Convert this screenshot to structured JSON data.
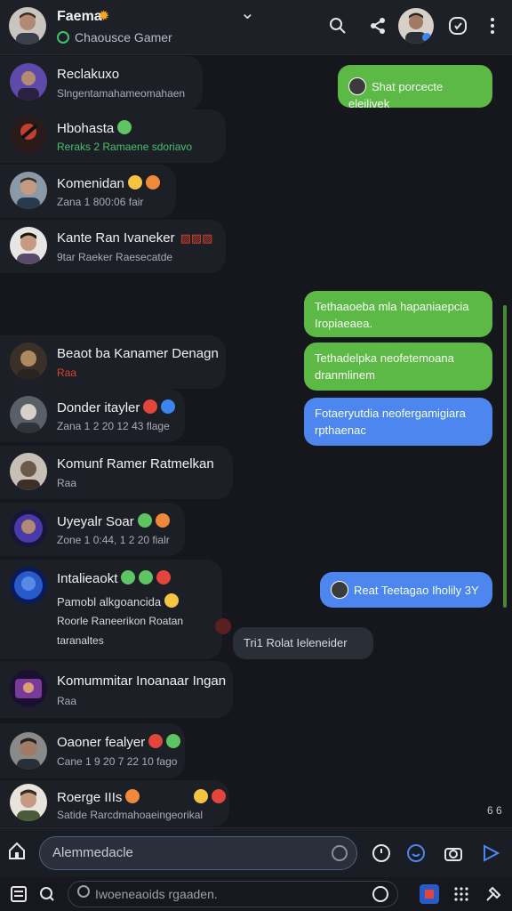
{
  "header": {
    "title": "Faema",
    "subtitle": "Chaousce Gamer",
    "emoji": "sun-emoji"
  },
  "contacts": [
    {
      "name": "Reclakuxo",
      "sub": "Slngentamahameomahaen",
      "sub_style": "grey",
      "avatar_color": "#5e4aa8"
    },
    {
      "name": "Hbohasta",
      "sub": "Reraks  2  Ramaene sdoriavo",
      "sub_style": "green",
      "avatar_color": "#a83b2c"
    },
    {
      "name": "Komenidan",
      "sub": "Zana 1 800:06  fair",
      "sub_style": "grey",
      "avatar_color": "#6a7a8c"
    },
    {
      "name": "Kante Ran Ivaneker",
      "sub": "9tar Raeker  Raesecatde",
      "sub_style": "grey",
      "avatar_color": "#4a4a58"
    },
    {
      "name": "Beaot ba Kanamer Denagn",
      "sub": "Raa",
      "sub_style": "grey",
      "avatar_color": "#5a4a38"
    },
    {
      "name": "Donder itayler",
      "sub": "Zana 1 2 20 12 43  flage",
      "sub_style": "grey",
      "avatar_color": "#4a5058"
    },
    {
      "name": "Komunf Ramer Ratmelkan",
      "sub": "Raa",
      "sub_style": "grey",
      "avatar_color": "#5a5048"
    },
    {
      "name": "Uyeyalr Soar",
      "sub": "Zone 1 0:44, 1 2 20 fialr",
      "sub_style": "grey",
      "avatar_color": "#3a2a78"
    },
    {
      "name": "Intalieaokt",
      "sub": "Pamobl alkgoancida",
      "sub2": "Roorle Raneerikon Roatan",
      "sub3": "taranaltes",
      "sub_style": "grey",
      "avatar_color": "#2a5ac8"
    },
    {
      "name": "Komummitar Inoanaar Ingan",
      "sub": "Raa",
      "sub_style": "grey",
      "avatar_color": "#6a3a78"
    },
    {
      "name": "Oaoner fealyer",
      "sub": "Cane 1 9 20 7 22 10 fago",
      "sub_style": "grey",
      "avatar_color": "#4a4a50"
    },
    {
      "name": "Roerge IIIs",
      "sub": "Satide Rarcdmahoaeingeorikal",
      "sub_style": "grey",
      "avatar_color": "#5a4a40"
    }
  ],
  "messages": [
    {
      "text": "Shat porcecte eleilivek",
      "style": "green"
    },
    {
      "text": "Tethaaoeba mla hapaniaepcia Iropiaeaea.",
      "style": "green"
    },
    {
      "text": "Tethadelpka neofetemoana dranmlinem",
      "style": "green"
    },
    {
      "text": "Fotaeryutdia neofergamigiara rpthaenac",
      "style": "blue"
    },
    {
      "text": "Reat Teetagao Iholily 3Y",
      "style": "blue"
    },
    {
      "text": "Tri1  Rolat Ieleneider",
      "style": "dark"
    }
  ],
  "composer": {
    "placeholder": "Alemmedacle"
  },
  "search": {
    "placeholder": "Iwoeneaoids rgaaden."
  },
  "page_indicator": "6 6"
}
